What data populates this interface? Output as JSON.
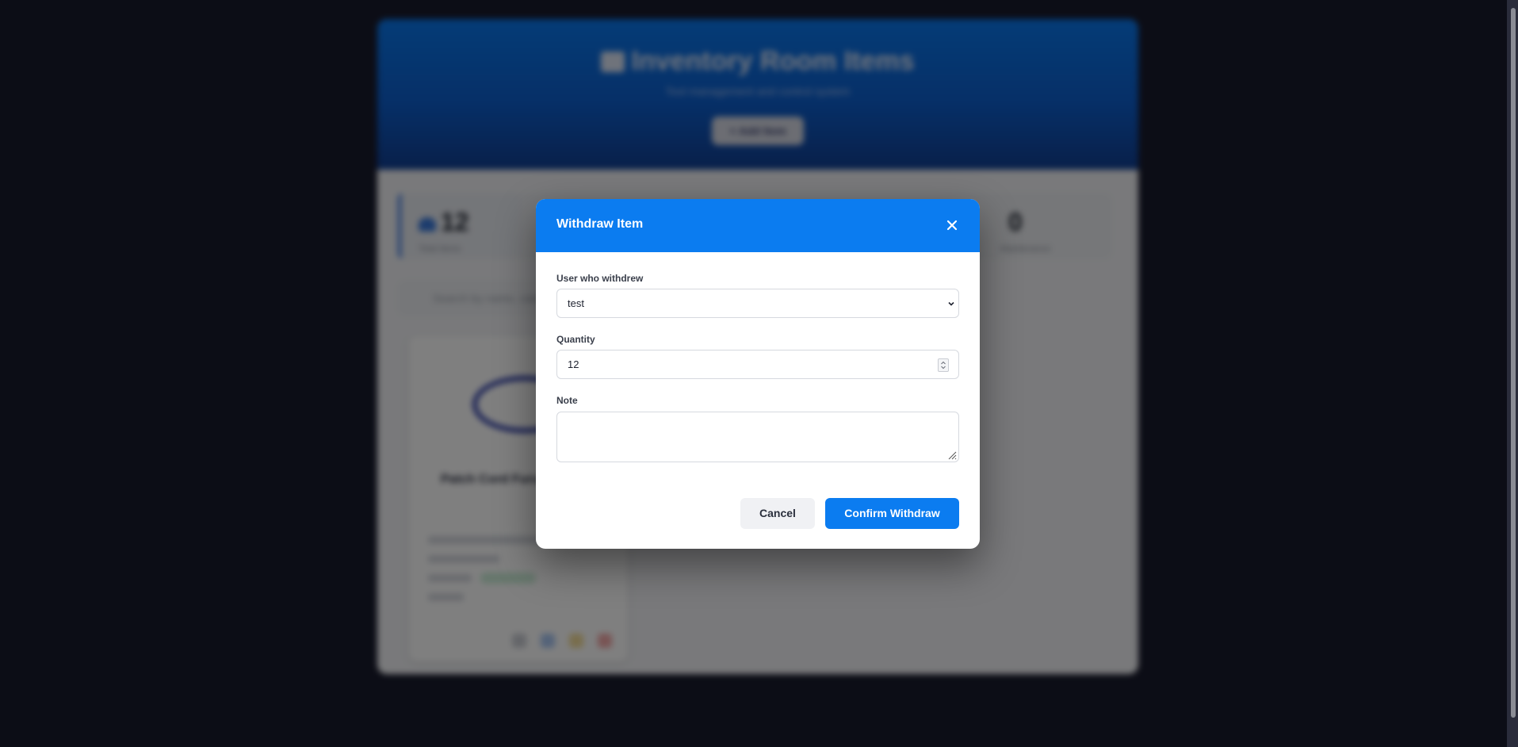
{
  "background": {
    "header_title": "Inventory Room Items",
    "header_subtitle": "Tool management and control system",
    "add_item_label": "+ Add Item",
    "stats": [
      {
        "value": "12",
        "label": "Total Items"
      },
      {
        "value": "0",
        "label": "Maintenance"
      }
    ],
    "search_placeholder": "Search by name, category...",
    "card": {
      "title": "Patch Cord Furu...",
      "status": "Good",
      "image_icon": "cable-icon"
    }
  },
  "modal": {
    "title": "Withdraw Item",
    "close_icon": "close-icon",
    "user_label": "User who withdrew",
    "user_value": "test",
    "quantity_label": "Quantity",
    "quantity_value": "12",
    "note_label": "Note",
    "note_value": "",
    "cancel_label": "Cancel",
    "confirm_label": "Confirm Withdraw"
  },
  "colors": {
    "accent": "#0b7cf0",
    "backdrop": "#191b2d"
  }
}
